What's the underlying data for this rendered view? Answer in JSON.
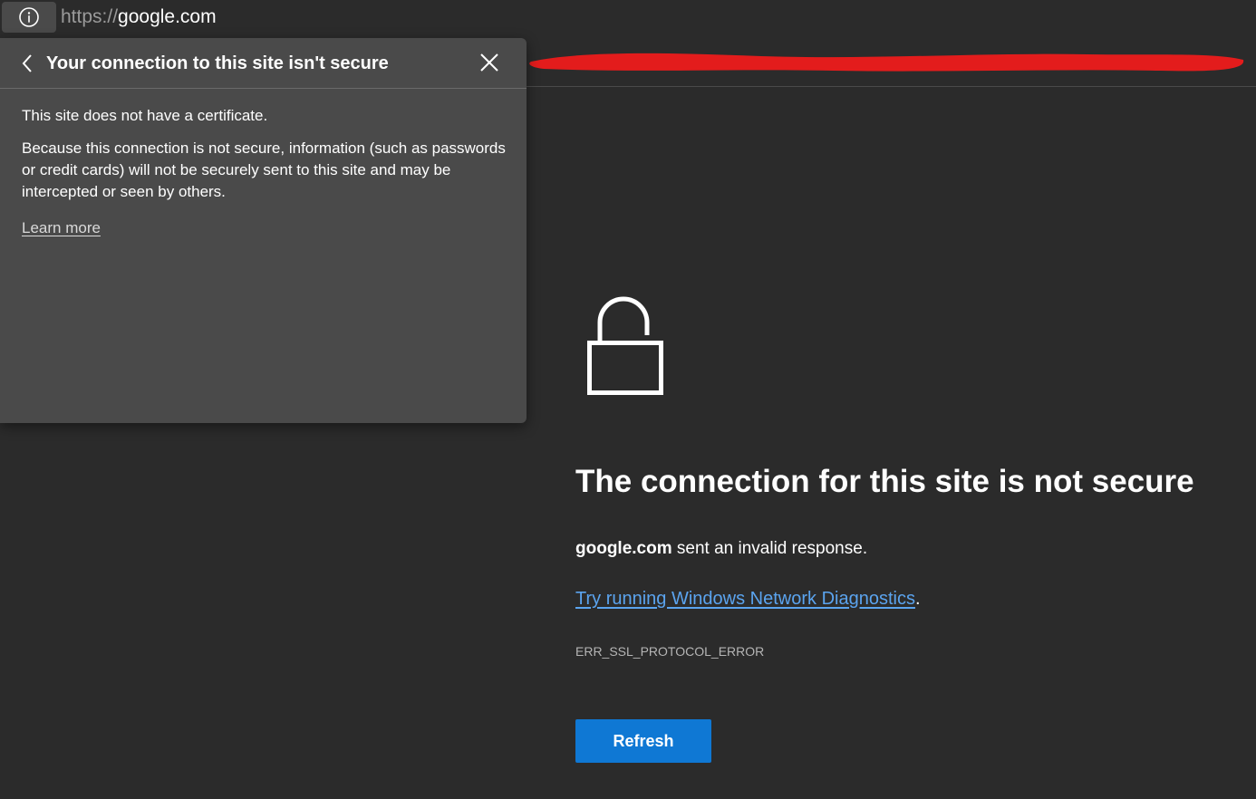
{
  "address_bar": {
    "url_scheme": "https://",
    "url_host": "google.com",
    "site_info_icon": "info-icon"
  },
  "popup": {
    "title": "Your connection to this site isn't secure",
    "back_icon": "chevron-left-icon",
    "close_icon": "close-icon",
    "paragraph_1": "This site does not have a certificate.",
    "paragraph_2": "Because this connection is not secure, information (such as passwords or credit cards) will not be securely sent to this site and may be intercepted or seen by others.",
    "learn_more": "Learn more"
  },
  "main": {
    "lock_icon": "unlocked-padlock-icon",
    "title": "The connection for this site is not secure",
    "desc_host": "google.com",
    "desc_rest": " sent an invalid response.",
    "diagnostics_link": "Try running Windows Network Diagnostics",
    "diagnostics_suffix": ".",
    "error_code": "ERR_SSL_PROTOCOL_ERROR",
    "refresh_label": "Refresh"
  },
  "colors": {
    "background": "#2b2b2b",
    "popup_background": "#4a4a4a",
    "link": "#5ba4ef",
    "button": "#0f78d4",
    "redaction": "#e31c1c"
  }
}
